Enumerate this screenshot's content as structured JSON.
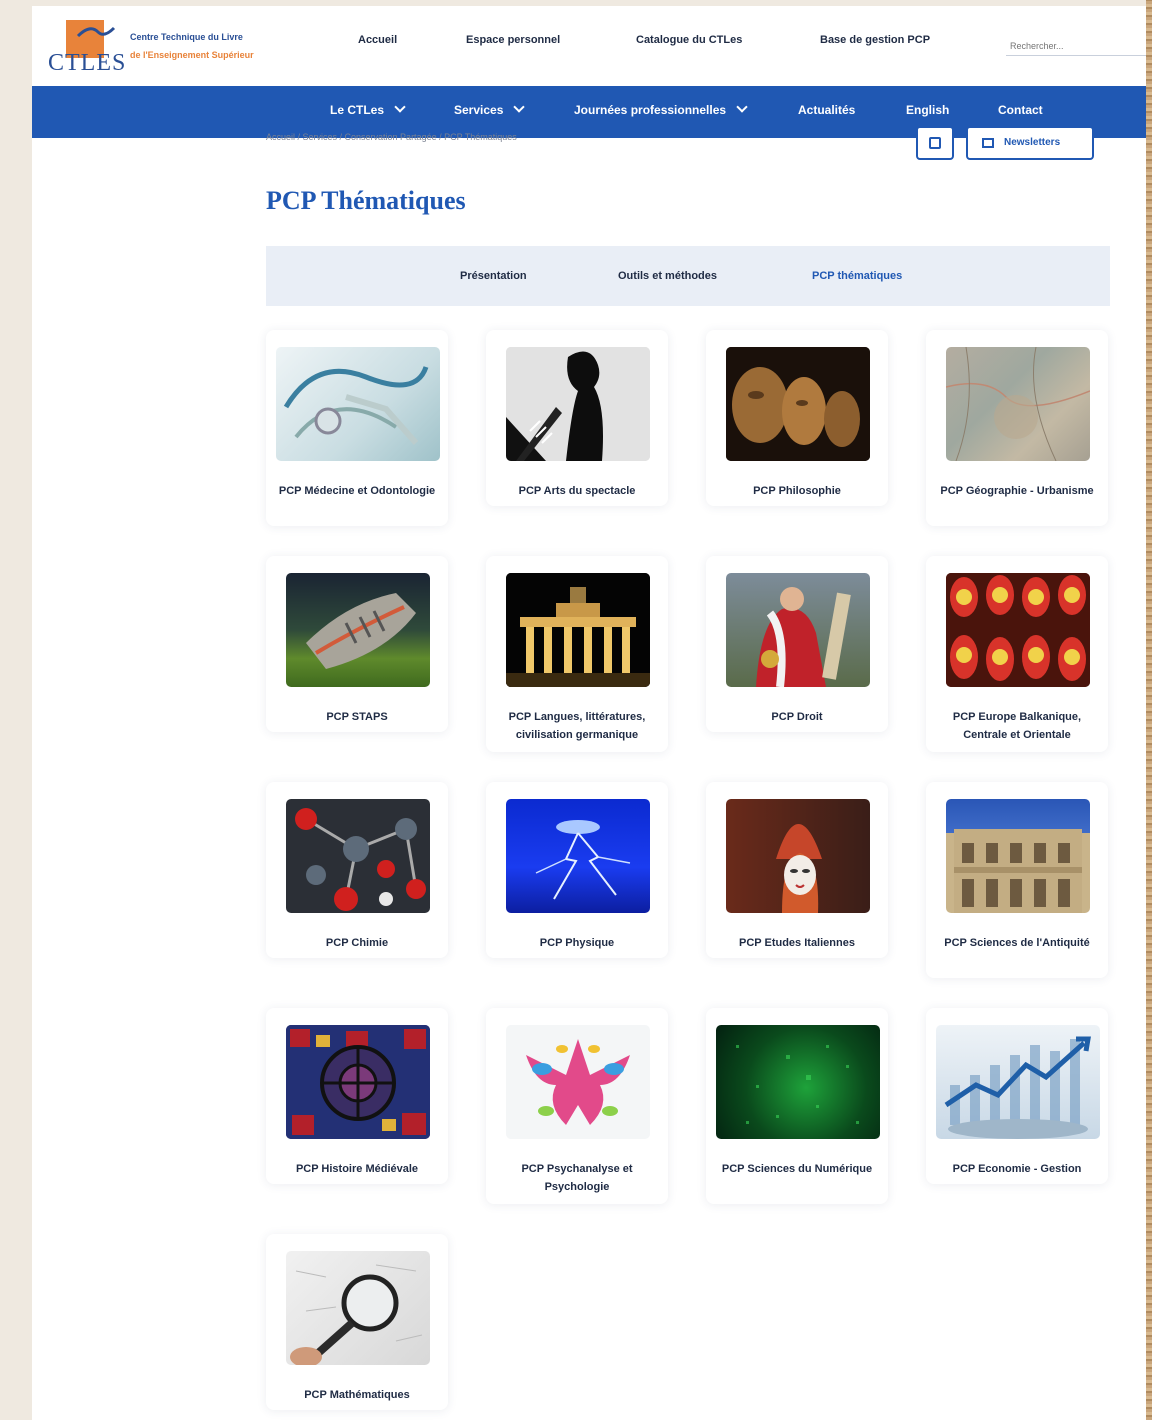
{
  "logo": {
    "letters": "CTLES",
    "line1": "Centre Technique du Livre",
    "line2": "de l'Enseignement Supérieur"
  },
  "top_nav": [
    "Accueil",
    "Espace personnel",
    "Catalogue du CTLes",
    "Base de gestion PCP"
  ],
  "search": {
    "placeholder": "Rechercher..."
  },
  "main_nav": [
    {
      "label": "Le CTLes",
      "dropdown": true
    },
    {
      "label": "Services",
      "dropdown": true
    },
    {
      "label": "Journées professionnelles",
      "dropdown": true
    },
    {
      "label": "Actualités",
      "dropdown": false
    },
    {
      "label": "English",
      "dropdown": false
    },
    {
      "label": "Contact",
      "dropdown": false
    }
  ],
  "breadcrumb": "Accueil / Services / Conservation Partagée / PCP Thématiques",
  "actions": {
    "newsletter_label": "Newsletters",
    "print_icon": "print-icon",
    "newsletter_icon": "mail-icon"
  },
  "page_title": "PCP Thématiques",
  "tabs": [
    {
      "label": "Présentation",
      "active": false
    },
    {
      "label": "Outils et méthodes",
      "active": false
    },
    {
      "label": "PCP thématiques",
      "active": true
    }
  ],
  "cards": [
    {
      "label": "PCP Médecine et Odontologie",
      "image": "stethoscope"
    },
    {
      "label": "PCP Arts du spectacle",
      "image": "shadow-on-stairs"
    },
    {
      "label": "PCP Philosophie",
      "image": "busts"
    },
    {
      "label": "PCP Géographie - Urbanisme",
      "image": "old-map"
    },
    {
      "label": "PCP STAPS",
      "image": "running-shoe"
    },
    {
      "label": "PCP Langues, littératures, civilisation germanique",
      "image": "brandenburg-gate"
    },
    {
      "label": "PCP Droit",
      "image": "judge-robes"
    },
    {
      "label": "PCP Europe Balkanique, Centrale et Orientale",
      "image": "matryoshka-dolls"
    },
    {
      "label": "PCP Chimie",
      "image": "molecule-model"
    },
    {
      "label": "PCP Physique",
      "image": "lightning"
    },
    {
      "label": "PCP Etudes Italiennes",
      "image": "venetian-mask"
    },
    {
      "label": "PCP Sciences de l'Antiquité",
      "image": "library-of-celsus"
    },
    {
      "label": "PCP Histoire Médiévale",
      "image": "stained-glass"
    },
    {
      "label": "PCP Psychanalyse et Psychologie",
      "image": "rorschach"
    },
    {
      "label": "PCP Sciences du Numérique",
      "image": "green-code"
    },
    {
      "label": "PCP Economie - Gestion",
      "image": "rising-graph"
    },
    {
      "label": "PCP Mathématiques",
      "image": "magnifying-glass"
    }
  ],
  "colors": {
    "brand_blue": "#2058b3",
    "brand_orange": "#e8833a",
    "tabs_bg": "#e9eef6",
    "text_dark": "#1f2b44"
  }
}
